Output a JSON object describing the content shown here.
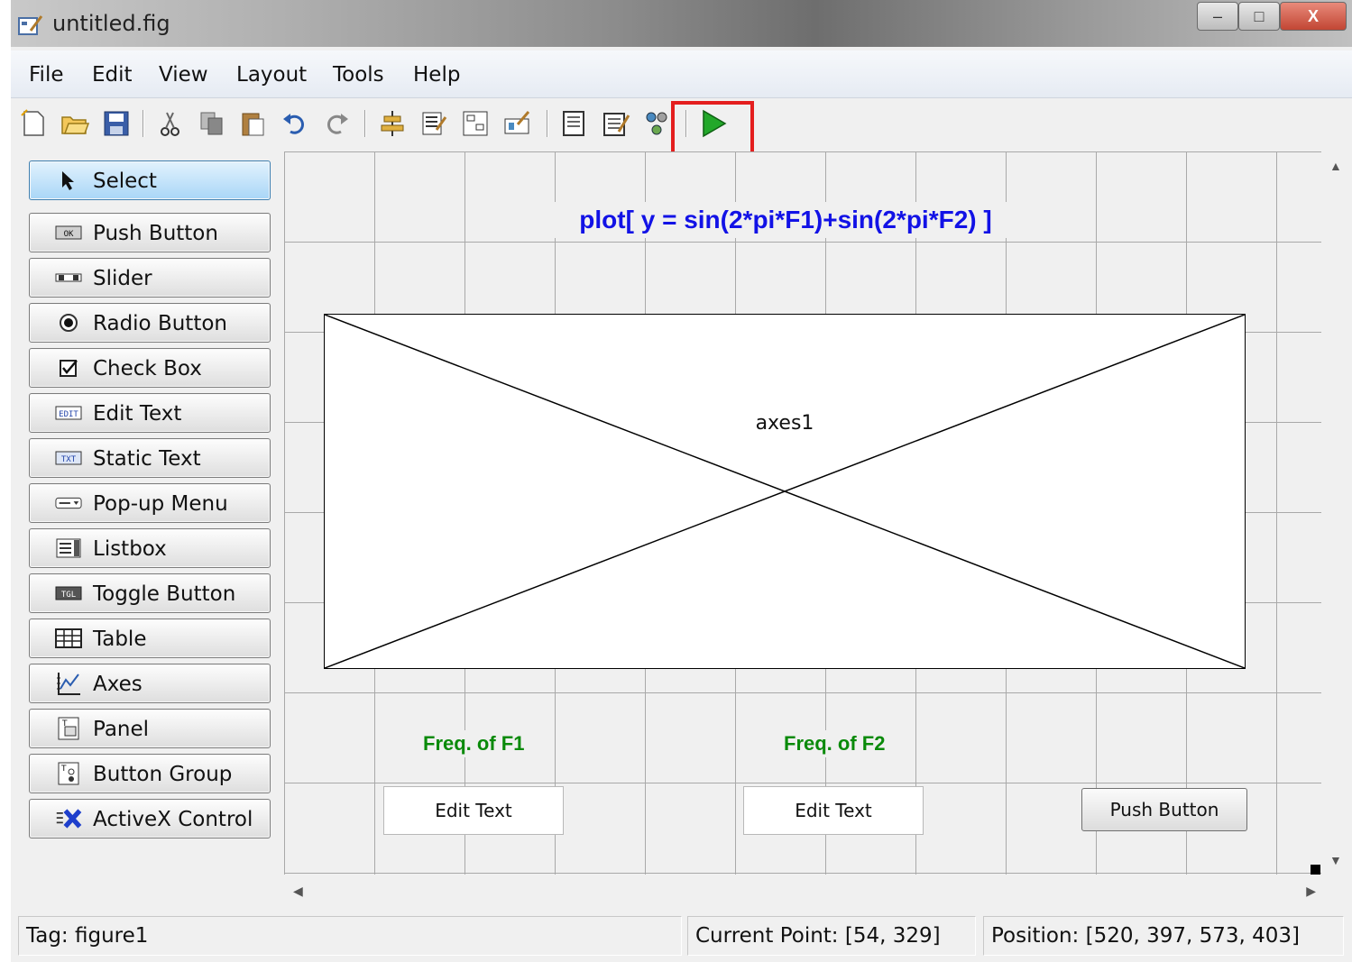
{
  "window": {
    "title": "untitled.fig",
    "controls": {
      "minimize": "–",
      "maximize": "□",
      "close": "X"
    }
  },
  "menu": [
    "File",
    "Edit",
    "View",
    "Layout",
    "Tools",
    "Help"
  ],
  "toolbar": {
    "icons": [
      "new-icon",
      "open-icon",
      "save-icon",
      "cut-icon",
      "copy-icon",
      "paste-icon",
      "undo-icon",
      "redo-icon",
      "align-icon",
      "menu-editor-icon",
      "tab-order-icon",
      "toolbar-editor-icon",
      "editor-icon",
      "property-inspector-icon",
      "object-browser-icon",
      "run-icon"
    ],
    "run_highlight_color": "#e41e1e"
  },
  "palette": {
    "items": [
      {
        "label": "Select",
        "icon": "arrow-icon"
      },
      {
        "label": "Push Button",
        "icon": "push-button-icon"
      },
      {
        "label": "Slider",
        "icon": "slider-icon"
      },
      {
        "label": "Radio Button",
        "icon": "radio-button-icon"
      },
      {
        "label": "Check Box",
        "icon": "check-box-icon"
      },
      {
        "label": "Edit Text",
        "icon": "edit-text-icon"
      },
      {
        "label": "Static Text",
        "icon": "static-text-icon"
      },
      {
        "label": "Pop-up Menu",
        "icon": "popup-menu-icon"
      },
      {
        "label": "Listbox",
        "icon": "listbox-icon"
      },
      {
        "label": "Toggle Button",
        "icon": "toggle-button-icon"
      },
      {
        "label": "Table",
        "icon": "table-icon"
      },
      {
        "label": "Axes",
        "icon": "axes-icon"
      },
      {
        "label": "Panel",
        "icon": "panel-icon"
      },
      {
        "label": "Button Group",
        "icon": "button-group-icon"
      },
      {
        "label": "ActiveX Control",
        "icon": "activex-icon"
      }
    ],
    "selected": "Select"
  },
  "canvas": {
    "title": "plot[ y = sin(2*pi*F1)+sin(2*pi*F2) ]",
    "title_color": "#1212e6",
    "axes_label": "axes1",
    "freq1_label": "Freq. of F1",
    "freq2_label": "Freq. of F2",
    "label_color": "#0a8a0a",
    "edit1": "Edit Text",
    "edit2": "Edit Text",
    "push_button": "Push Button"
  },
  "status": {
    "tag": "Tag: figure1",
    "current_point": "Current Point:  [54, 329]",
    "position": "Position: [520, 397, 573, 403]"
  }
}
